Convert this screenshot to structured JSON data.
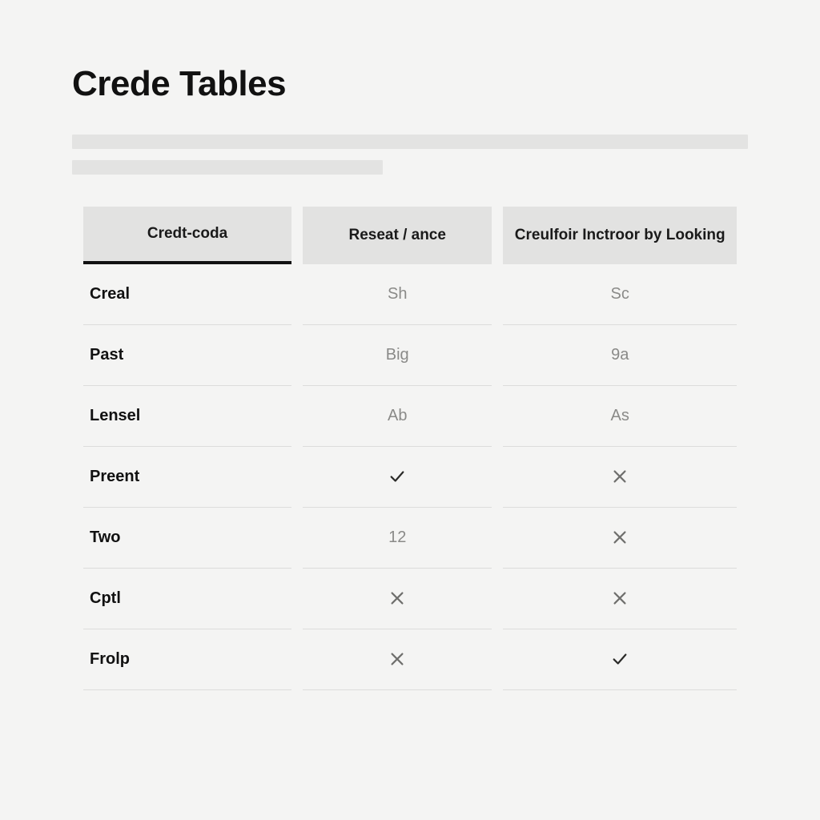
{
  "title": "Crede Tables",
  "table": {
    "headers": [
      "Credt-coda",
      "Reseat / ance",
      "Creulfoir Inctroor by Looking"
    ],
    "rows": [
      {
        "label": "Creal",
        "c1": {
          "type": "text",
          "value": "Sh"
        },
        "c2": {
          "type": "text",
          "value": "Sc"
        }
      },
      {
        "label": "Past",
        "c1": {
          "type": "text",
          "value": "Big"
        },
        "c2": {
          "type": "text",
          "value": "9a"
        }
      },
      {
        "label": "Lensel",
        "c1": {
          "type": "text",
          "value": "Ab"
        },
        "c2": {
          "type": "text",
          "value": "As"
        }
      },
      {
        "label": "Preent",
        "c1": {
          "type": "check"
        },
        "c2": {
          "type": "cross"
        }
      },
      {
        "label": "Two",
        "c1": {
          "type": "text",
          "value": "12"
        },
        "c2": {
          "type": "cross"
        }
      },
      {
        "label": "Cptl",
        "c1": {
          "type": "cross"
        },
        "c2": {
          "type": "cross"
        }
      },
      {
        "label": "Frolp",
        "c1": {
          "type": "cross"
        },
        "c2": {
          "type": "check"
        }
      }
    ]
  }
}
